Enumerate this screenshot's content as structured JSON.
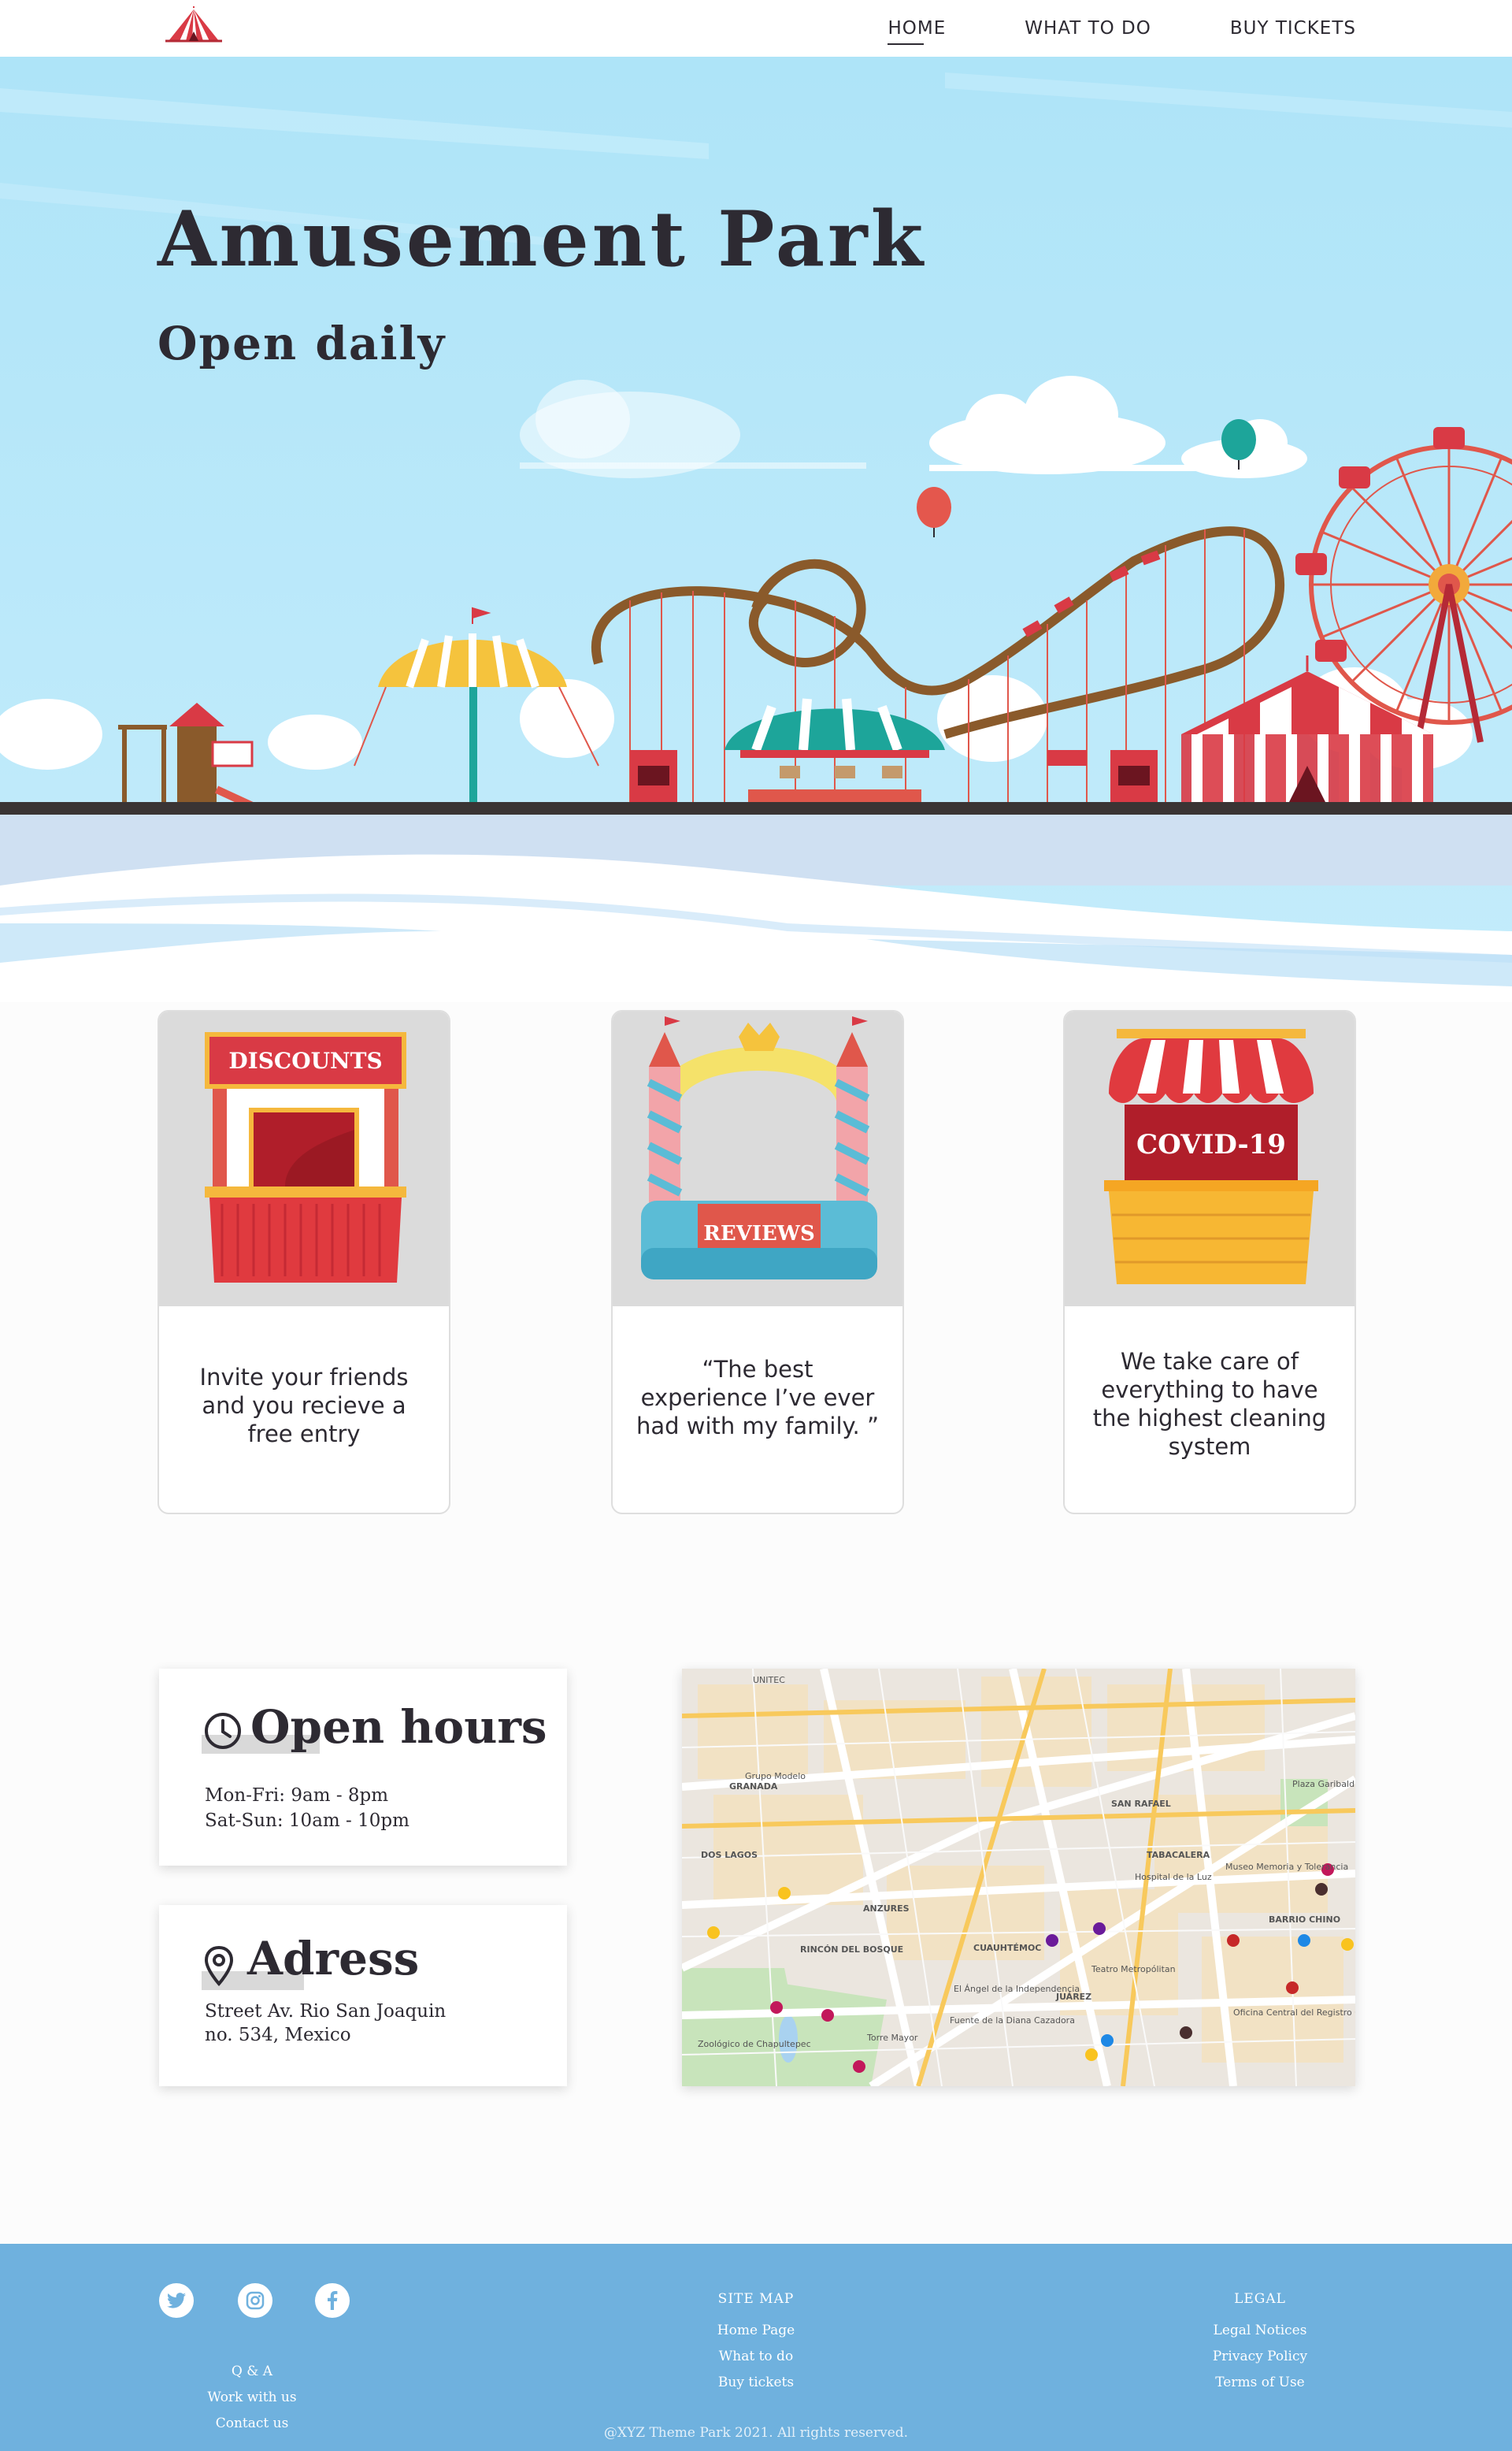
{
  "nav": {
    "links": [
      "HOME",
      "WHAT TO DO",
      "BUY TICKETS"
    ]
  },
  "hero": {
    "title": "Amusement Park",
    "subtitle": "Open daily"
  },
  "cards": [
    {
      "sign": "DISCOUNTS",
      "text": "Invite your friends and you recieve a free entry"
    },
    {
      "sign": "REVIEWS",
      "text": "“The best experience I’ve ever had with my family. ”"
    },
    {
      "sign": "COVID-19",
      "text": "We take care of everything to have the highest cleaning system"
    }
  ],
  "hours": {
    "title": "Open hours",
    "lines": [
      "Mon-Fri: 9am - 8pm",
      "Sat-Sun: 10am - 10pm"
    ]
  },
  "address": {
    "title": "Adress",
    "lines": [
      "Street Av. Rio San Joaquin",
      "no. 534, Mexico"
    ]
  },
  "map": {
    "labels": [
      "UNITEC",
      "Grupo Modelo",
      "GRANADA",
      "DOS LAGOS",
      "SAN RAFAEL",
      "TABACALERA",
      "Plaza Garibaldi",
      "BARRIO CHINO",
      "ANZURES",
      "RINCÓN DEL BOSQUE",
      "CUAUHTÉMOC",
      "JUÁREZ",
      "Torre Mayor",
      "El Ángel de la Independencia",
      "Teatro Metropólitan",
      "Hospital de la Luz",
      "Museo Memoria y Tolerancia",
      "Zoológico de Chapultepec",
      "Oficina Central del Registro Civil",
      "Fuente de la Diana Cazadora"
    ]
  },
  "footer": {
    "social_icons": [
      "twitter-icon",
      "instagram-icon",
      "facebook-icon"
    ],
    "col1_links": [
      "Q & A",
      "Work with us",
      "Contact us"
    ],
    "sitemap_title": "SITE MAP",
    "sitemap_links": [
      "Home Page",
      "What to do",
      "Buy tickets"
    ],
    "legal_title": "LEGAL",
    "legal_links": [
      "Legal Notices",
      "Privacy Policy",
      "Terms of Use"
    ],
    "copyright": "@XYZ Theme Park 2021. All rights reserved."
  },
  "colors": {
    "sky": "#b3e6fa",
    "footer": "#6fb1de",
    "text": "#2d2a32",
    "red": "#d93a45"
  }
}
